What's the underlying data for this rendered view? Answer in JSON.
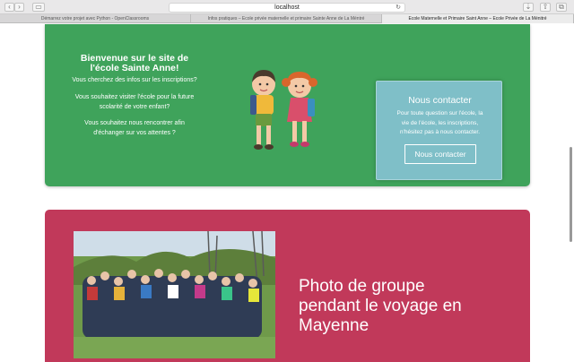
{
  "browser": {
    "url": "localhost",
    "tabs": [
      {
        "label": "Démarrez votre projet avec Python - OpenClassrooms"
      },
      {
        "label": "Infos pratiques – Ecole privée maternelle et primaire Sainte Anne de La Méntré"
      },
      {
        "label": "Ecole Maternelle et Primaire Saint Anne – Ecole Privée de La Ménitré"
      }
    ]
  },
  "welcome": {
    "title_line1": "Bienvenue sur le site de",
    "title_line2": "l'école Sainte Anne!",
    "p1": "Vous cherchez des infos sur les inscriptions?",
    "p2_line1": "Vous souhaitez visiter l'école pour la future",
    "p2_line2": "scolarité de votre enfant?",
    "p3_line1": "Vous souhaitez nous rencontrer afin",
    "p3_line2": "d'échanger sur vos attentes ?"
  },
  "contact": {
    "title": "Nous contacter",
    "text_line1": "Pour toute question sur l'école, la",
    "text_line2": "vie de l'école, les inscriptions,",
    "text_line3": "n'hésitez pas à nous contacter.",
    "button": "Nous contacter"
  },
  "gallery": {
    "caption_line1": "Photo de groupe",
    "caption_line2": "pendant le voyage en",
    "caption_line3": "Mayenne"
  },
  "colors": {
    "green": "#3fa35b",
    "teal": "#7fbfc8",
    "red": "#c1395a"
  }
}
